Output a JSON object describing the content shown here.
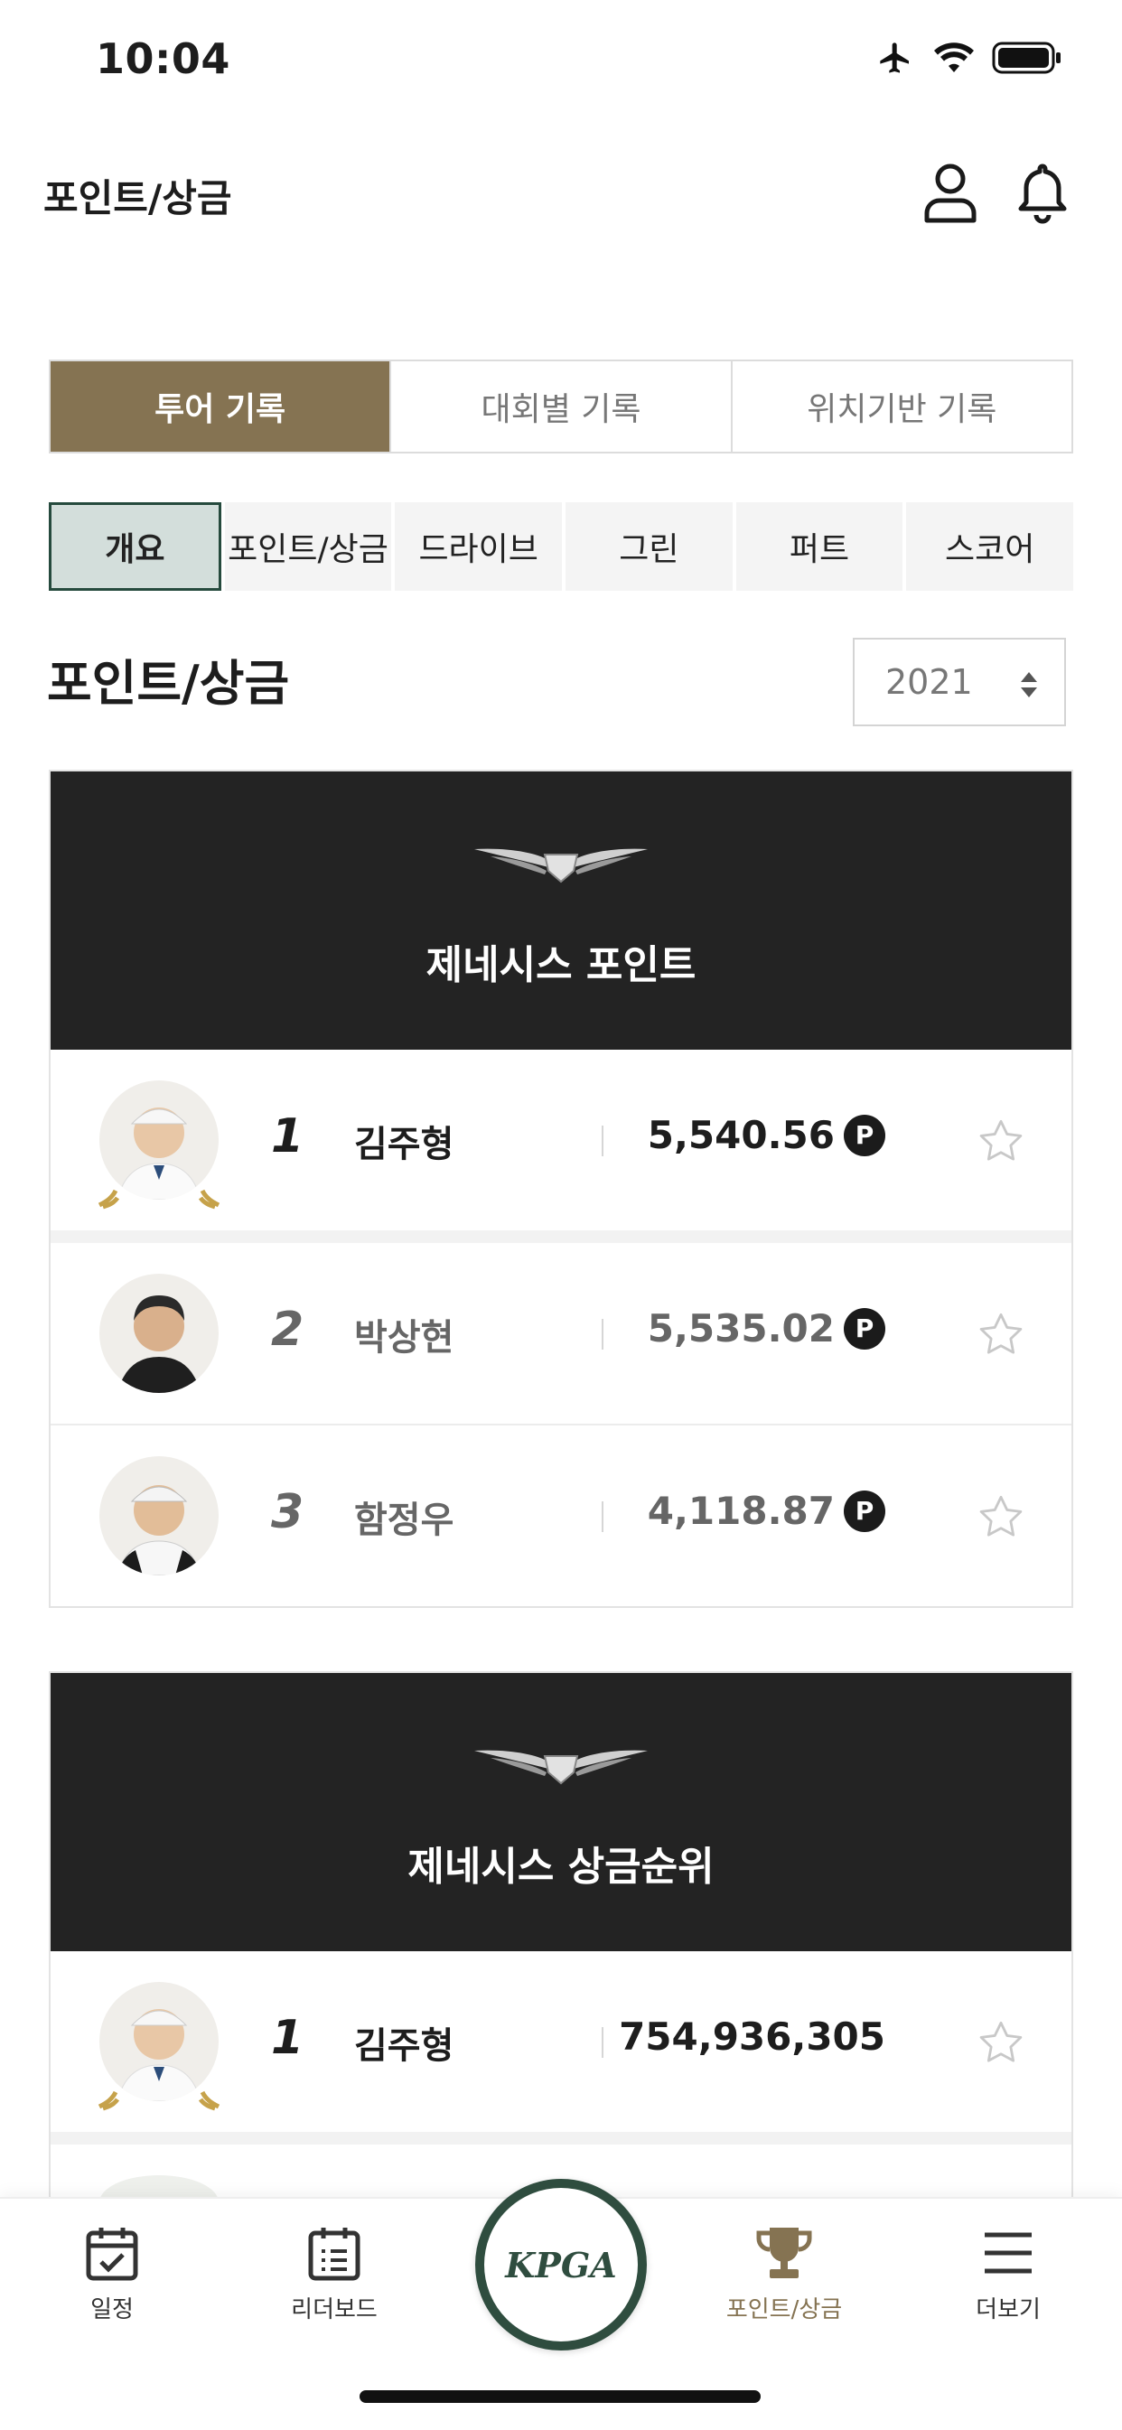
{
  "status_bar": {
    "time": "10:04"
  },
  "header": {
    "title": "포인트/상금"
  },
  "segment_tabs": [
    {
      "label": "투어 기록",
      "active": true
    },
    {
      "label": "대회별 기록",
      "active": false
    },
    {
      "label": "위치기반 기록",
      "active": false
    }
  ],
  "sub_tabs": [
    {
      "label": "개요",
      "active": true
    },
    {
      "label": "포인트/상금",
      "active": false
    },
    {
      "label": "드라이브",
      "active": false
    },
    {
      "label": "그린",
      "active": false
    },
    {
      "label": "퍼트",
      "active": false
    },
    {
      "label": "스코어",
      "active": false
    }
  ],
  "section": {
    "title": "포인트/상금",
    "year": "2021"
  },
  "points_card": {
    "title": "제네시스 포인트",
    "point_badge": "P",
    "rows": [
      {
        "rank": "1",
        "name": "김주형",
        "value": "5,540.56"
      },
      {
        "rank": "2",
        "name": "박상현",
        "value": "5,535.02"
      },
      {
        "rank": "3",
        "name": "함정우",
        "value": "4,118.87"
      }
    ]
  },
  "money_card": {
    "title": "제네시스 상금순위",
    "rows": [
      {
        "rank": "1",
        "name": "김주형",
        "value": "754,936,305"
      }
    ]
  },
  "bottom_nav": {
    "items": [
      {
        "label": "일정",
        "icon": "calendar-check-icon"
      },
      {
        "label": "리더보드",
        "icon": "leaderboard-icon"
      },
      {
        "label": "포인트/상금",
        "icon": "trophy-icon",
        "active": true
      },
      {
        "label": "더보기",
        "icon": "menu-icon"
      }
    ],
    "center_logo": "KPGA"
  },
  "colors": {
    "accent_gold": "#857352",
    "dark_green": "#2f4d3f",
    "card_header": "#232323"
  }
}
